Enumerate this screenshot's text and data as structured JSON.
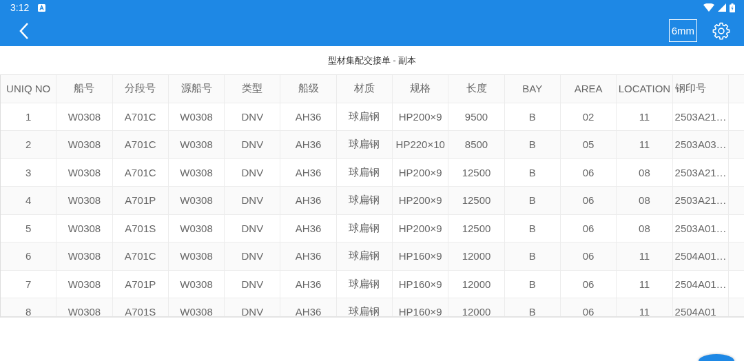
{
  "status_bar": {
    "time": "3:12"
  },
  "app_bar": {
    "unit_button": "6mm"
  },
  "title": "型材集配交接单 - 副本",
  "table": {
    "columns": [
      "UNIQ NO",
      "船号",
      "分段号",
      "源船号",
      "类型",
      "船级",
      "材质",
      "规格",
      "长度",
      "BAY",
      "AREA",
      "LOCATION",
      "钢印号"
    ],
    "rows": [
      [
        "1",
        "W0308",
        "A701C",
        "W0308",
        "DNV",
        "AH36",
        "球扁钢",
        "HP200×9",
        "9500",
        "B",
        "02",
        "11",
        "2503A21…"
      ],
      [
        "2",
        "W0308",
        "A701C",
        "W0308",
        "DNV",
        "AH36",
        "球扁钢",
        "HP220×10",
        "8500",
        "B",
        "05",
        "11",
        "2503A03…"
      ],
      [
        "3",
        "W0308",
        "A701C",
        "W0308",
        "DNV",
        "AH36",
        "球扁钢",
        "HP200×9",
        "12500",
        "B",
        "06",
        "08",
        "2503A21…"
      ],
      [
        "4",
        "W0308",
        "A701P",
        "W0308",
        "DNV",
        "AH36",
        "球扁钢",
        "HP200×9",
        "12500",
        "B",
        "06",
        "08",
        "2503A21…"
      ],
      [
        "5",
        "W0308",
        "A701S",
        "W0308",
        "DNV",
        "AH36",
        "球扁钢",
        "HP200×9",
        "12500",
        "B",
        "06",
        "08",
        "2503A01…"
      ],
      [
        "6",
        "W0308",
        "A701C",
        "W0308",
        "DNV",
        "AH36",
        "球扁钢",
        "HP160×9",
        "12000",
        "B",
        "06",
        "11",
        "2504A01…"
      ],
      [
        "7",
        "W0308",
        "A701P",
        "W0308",
        "DNV",
        "AH36",
        "球扁钢",
        "HP160×9",
        "12000",
        "B",
        "06",
        "11",
        "2504A01…"
      ],
      [
        "8",
        "W0308",
        "A701S",
        "W0308",
        "DNV",
        "AH36",
        "球扁钢",
        "HP160×9",
        "12000",
        "B",
        "06",
        "11",
        "2504A01"
      ]
    ]
  }
}
